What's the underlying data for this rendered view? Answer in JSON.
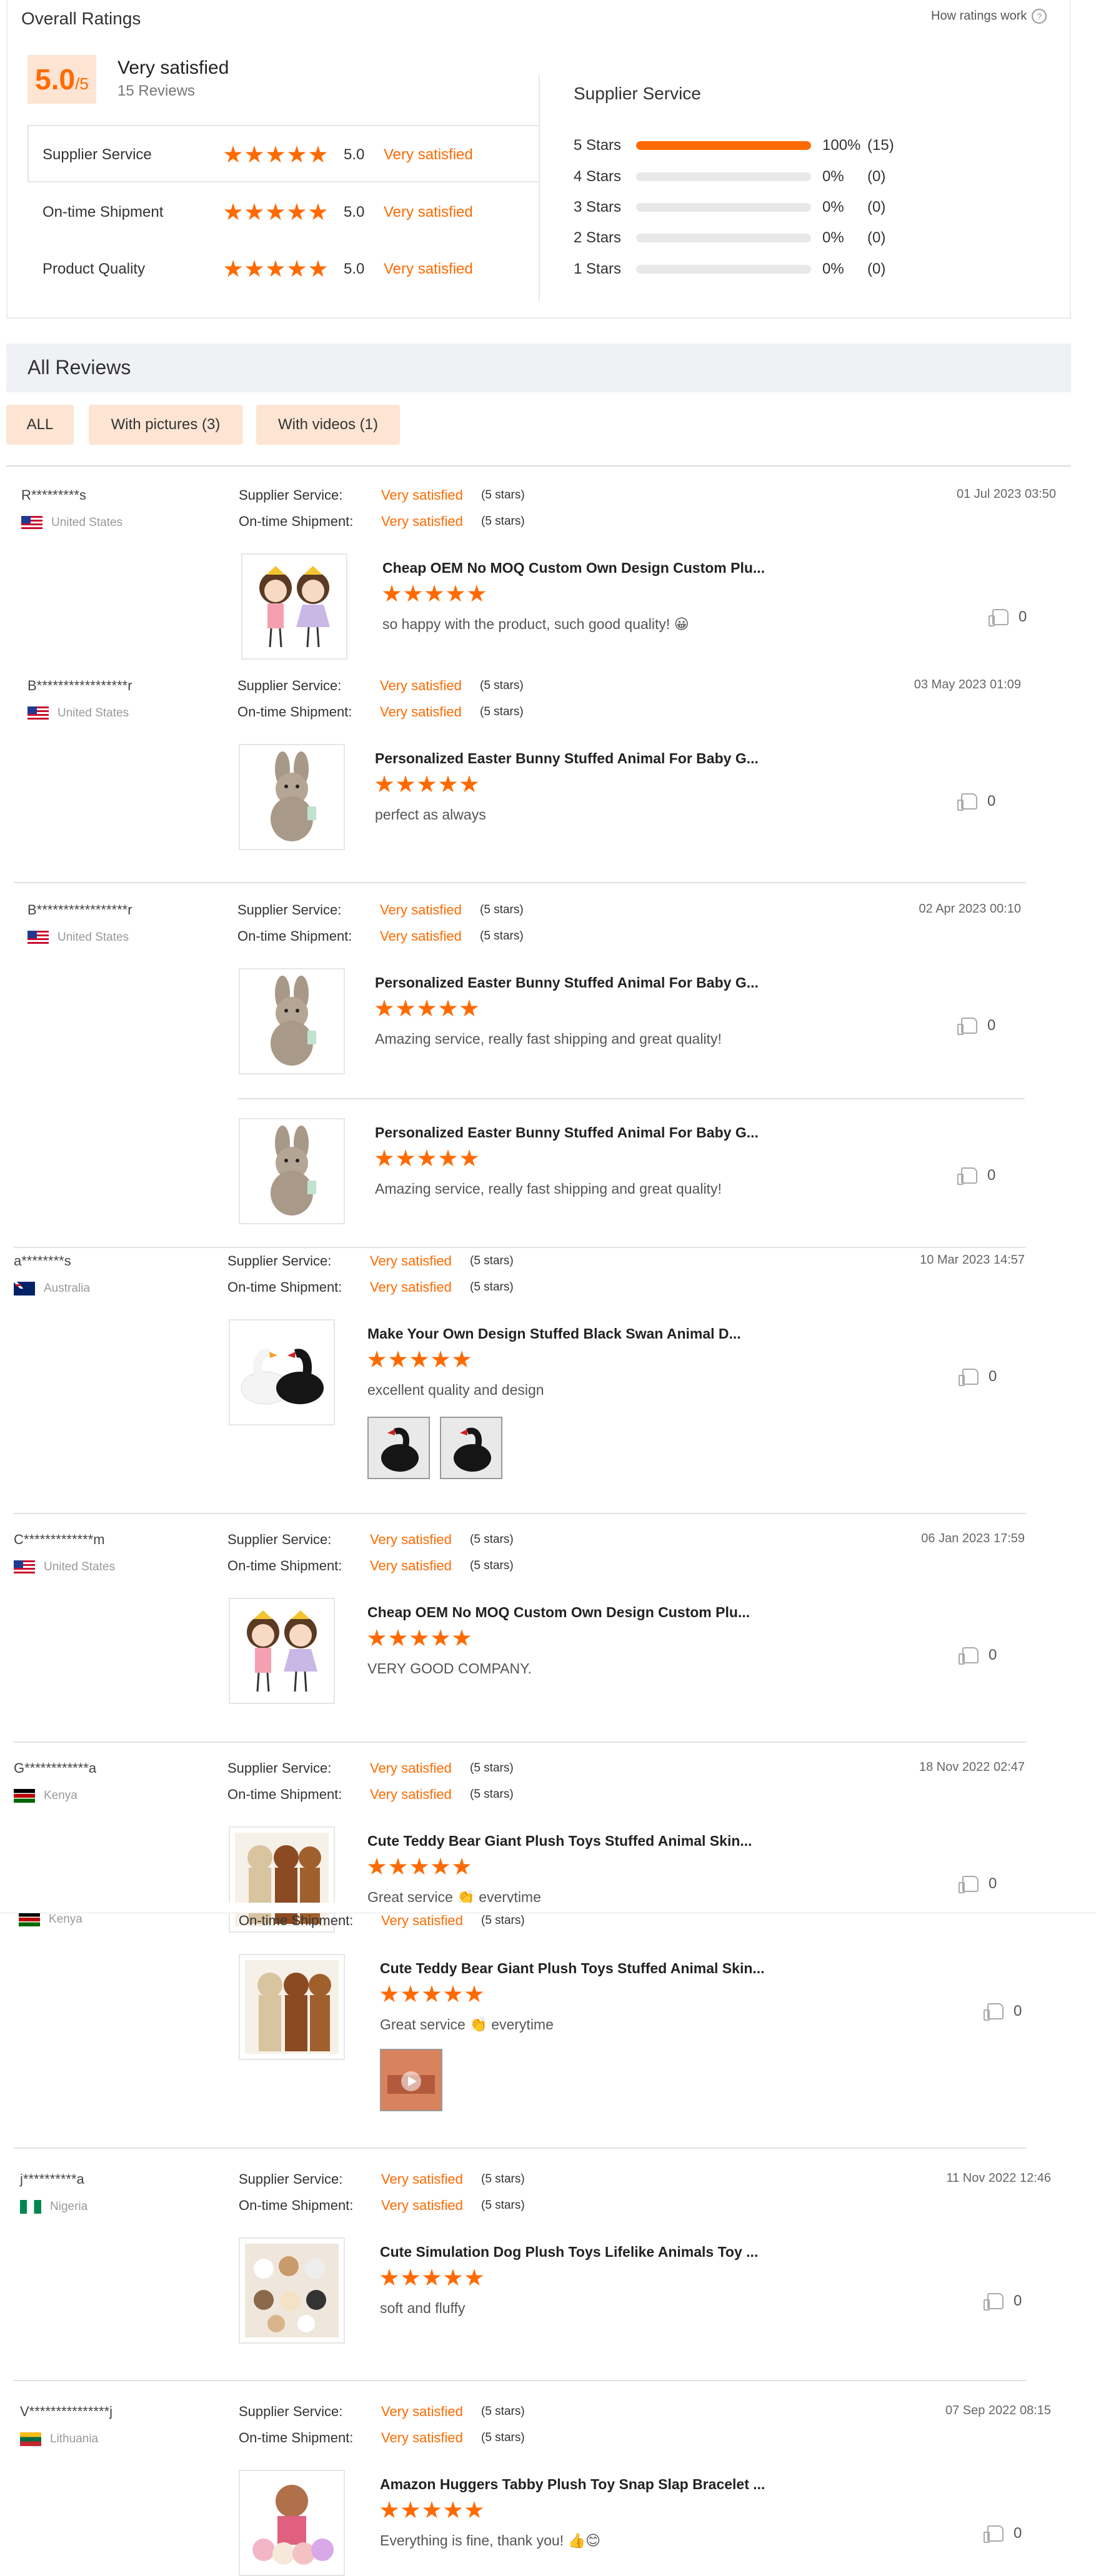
{
  "ratings": {
    "title": "Overall Ratings",
    "how_link": "How ratings work",
    "help_icon": "?",
    "score": "5.0",
    "score_of": "/5",
    "overall_label": "Very satisfied",
    "reviews_count": "15 Reviews",
    "sub_ratings": [
      {
        "label": "Supplier Service",
        "score": "5.0",
        "text": "Very satisfied",
        "stars": 5
      },
      {
        "label": "On-time Shipment",
        "score": "5.0",
        "text": "Very satisfied",
        "stars": 5
      },
      {
        "label": "Product Quality",
        "score": "5.0",
        "text": "Very satisfied",
        "stars": 5
      }
    ],
    "distribution_title": "Supplier Service",
    "distribution": [
      {
        "label": "5 Stars",
        "fraction": 1.0,
        "pct": "100%",
        "count": "(15)"
      },
      {
        "label": "4 Stars",
        "fraction": 0,
        "pct": "0%",
        "count": "(0)"
      },
      {
        "label": "3 Stars",
        "fraction": 0,
        "pct": "0%",
        "count": "(0)"
      },
      {
        "label": "2 Stars",
        "fraction": 0,
        "pct": "0%",
        "count": "(0)"
      },
      {
        "label": "1 Stars",
        "fraction": 0,
        "pct": "0%",
        "count": "(0)"
      }
    ]
  },
  "reviews_header": {
    "title": "All Reviews",
    "filters": [
      "ALL",
      "With pictures (3)",
      "With videos (1)"
    ]
  },
  "labels": {
    "supplier_service": "Supplier Service:",
    "ontime_shipment": "On-time Shipment:",
    "very_satisfied": "Very satisfied",
    "five_stars": "(5 stars)"
  },
  "colors": {
    "accent": "#ff6a00",
    "accent_light": "#fde4d3",
    "header_bg": "#eff1f5"
  },
  "reviews": [
    {
      "name": "R*********s",
      "country": "United States",
      "flag": "us",
      "date": "01 Jul 2023 03:50",
      "product": "Cheap OEM No MOQ Custom Own Design Custom Plu...",
      "text": "so happy with the product, such good quality!",
      "emoji": "😀",
      "likes": "0"
    },
    {
      "name": "B*****************r",
      "country": "United States",
      "flag": "us",
      "date": "03 May 2023 01:09",
      "product": "Personalized Easter Bunny Stuffed Animal For Baby G...",
      "text": "perfect as always",
      "likes": "0"
    },
    {
      "name": "B*****************r",
      "country": "United States",
      "flag": "us",
      "date": "02 Apr 2023 00:10",
      "product": "Personalized Easter Bunny Stuffed Animal For Baby G...",
      "text": "Amazing service, really fast shipping and great quality!",
      "likes": "0",
      "product2": "Personalized Easter Bunny Stuffed Animal For Baby G...",
      "text2": "Amazing service, really fast shipping and great quality!",
      "likes2": "0"
    },
    {
      "name": "a********s",
      "country": "Australia",
      "flag": "au",
      "date": "10 Mar 2023 14:57",
      "product": "Make Your Own Design Stuffed Black Swan Animal D...",
      "text": "excellent quality and design",
      "likes": "0"
    },
    {
      "name": "C*************m",
      "country": "United States",
      "flag": "us",
      "date": "06 Jan 2023 17:59",
      "product": "Cheap OEM No MOQ Custom Own Design Custom Plu...",
      "text": "VERY GOOD COMPANY.",
      "likes": "0"
    },
    {
      "name": "G************a",
      "country": "Kenya",
      "flag": "ke",
      "date": "18 Nov 2022 02:47",
      "product": "Cute Teddy Bear Giant Plush Toys Stuffed Animal Skin...",
      "text": "Great service",
      "emoji": "👏",
      "text_after": "everytime",
      "likes": "0"
    },
    {
      "country": "Kenya",
      "flag": "ke",
      "product": "Cute Teddy Bear Giant Plush Toys Stuffed Animal Skin...",
      "text": "Great service",
      "emoji": "👏",
      "text_after": "everytime",
      "likes": "0"
    },
    {
      "name": "j**********a",
      "country": "Nigeria",
      "flag": "ng",
      "date": "11 Nov 2022 12:46",
      "product": "Cute Simulation Dog Plush Toys Lifelike Animals Toy ...",
      "text": "soft and fluffy",
      "likes": "0"
    },
    {
      "name": "V***************j",
      "country": "Lithuania",
      "flag": "lt",
      "date": "07 Sep 2022 08:15",
      "product": "Amazon Huggers Tabby Plush Toy Snap Slap Bracelet ...",
      "text": "Everything is fine, thank you!",
      "emoji": "👍😊",
      "likes": "0"
    }
  ]
}
